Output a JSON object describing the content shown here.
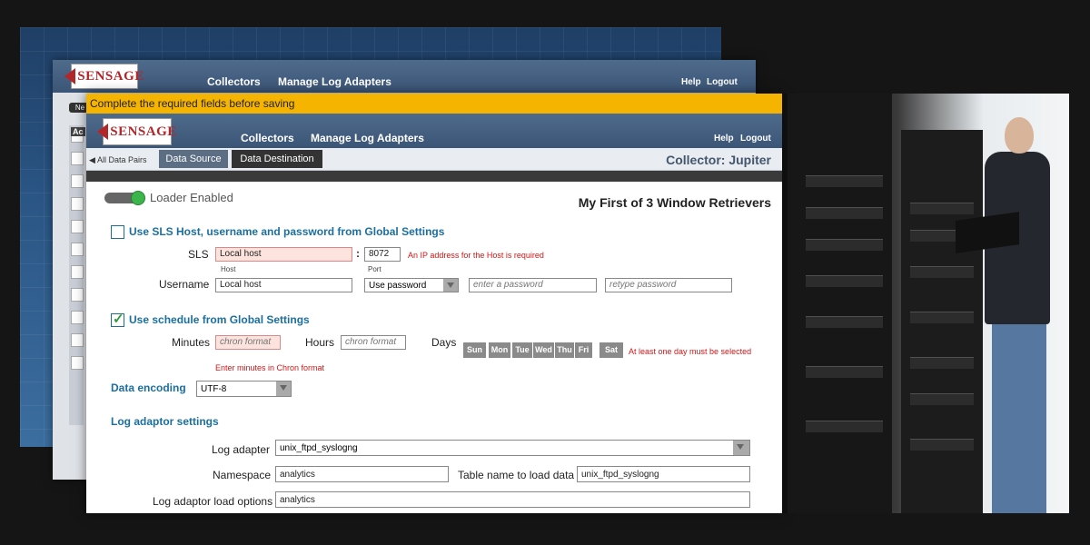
{
  "back_window": {},
  "mid_window": {
    "nav": {
      "collectors": "Collectors",
      "manage": "Manage Log Adapters",
      "help": "Help",
      "logout": "Logout"
    },
    "tag": "Ne",
    "panel_label": "Ac"
  },
  "front_window": {
    "alert": "Complete the required fields before saving",
    "logo": "SENSAGE",
    "nav": {
      "collectors": "Collectors",
      "manage": "Manage Log Adapters",
      "help": "Help",
      "logout": "Logout"
    },
    "subnav": {
      "back": "All Data Pairs",
      "tab_source": "Data Source",
      "tab_dest": "Data Destination",
      "collector": "Collector: Jupiter"
    },
    "loader_label": "Loader Enabled",
    "retriever_title": "My First of 3 Window Retrievers",
    "sls_section": "Use SLS Host, username and password from Global Settings",
    "sls_label": "SLS",
    "host_value": "Local host",
    "colon": ":",
    "port_value": "8072",
    "host_error": "An IP address for the Host is required",
    "host_caption": "Host",
    "port_caption": "Port",
    "username_label": "Username",
    "username_value": "Local host",
    "password_mode": "Use password",
    "password_placeholder": "enter a password",
    "retype_placeholder": "retype password",
    "schedule_section": "Use schedule from Global Settings",
    "minutes_label": "Minutes",
    "minutes_placeholder": "chron format",
    "hours_label": "Hours",
    "hours_placeholder": "chron format",
    "days_label": "Days",
    "days": [
      "Sun",
      "Mon",
      "Tue",
      "Wed",
      "Thu",
      "Fri",
      "Sat"
    ],
    "days_error": "At least one day must be selected",
    "minutes_error": "Enter minutes in Chron format",
    "encoding_label": "Data  encoding",
    "encoding_value": "UTF-8",
    "adaptor_section": "Log adaptor settings",
    "log_adapter_label": "Log adapter",
    "log_adapter_value": "unix_ftpd_syslogng",
    "namespace_label": "Namespace",
    "namespace_value": "analytics",
    "table_label": "Table name to load data",
    "table_value": "unix_ftpd_syslogng",
    "load_options_label": "Log adaptor load options",
    "load_options_value": "analytics"
  },
  "colors": {
    "accent": "#1b6fa0",
    "alert": "#f5b400",
    "error": "#d31515",
    "header": "#3b5577",
    "toggle_on": "#3cb64a"
  }
}
